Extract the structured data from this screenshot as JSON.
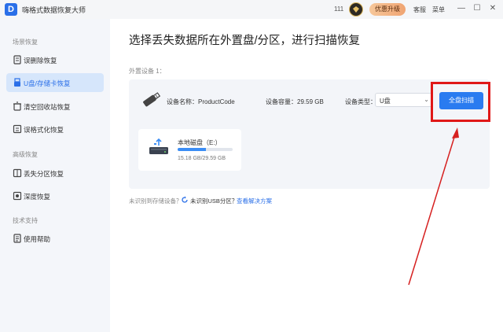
{
  "titlebar": {
    "app_title": "嗨格式数据恢复大师",
    "app_logo_letter": "D",
    "count": "111",
    "upgrade_label": "优惠升级",
    "service_label": "客服",
    "menu_label": "菜单",
    "minimize_glyph": "—",
    "maximize_glyph": "☐",
    "close_glyph": "✕"
  },
  "sidebar": {
    "section_scene": "场景恢复",
    "section_advanced": "高级恢复",
    "section_support": "技术支持",
    "items": [
      {
        "label": "误删除恢复",
        "icon": "deleted-file-icon",
        "active": false
      },
      {
        "label": "U盘/存储卡恢复",
        "icon": "usb-drive-icon",
        "active": true
      },
      {
        "label": "清空回收站恢复",
        "icon": "recycle-bin-icon",
        "active": false
      },
      {
        "label": "误格式化恢复",
        "icon": "format-icon",
        "active": false
      },
      {
        "label": "丢失分区恢复",
        "icon": "partition-icon",
        "active": false
      },
      {
        "label": "深度恢复",
        "icon": "deep-scan-icon",
        "active": false
      },
      {
        "label": "使用帮助",
        "icon": "help-doc-icon",
        "active": false
      }
    ]
  },
  "main": {
    "title": "选择丢失数据所在外置盘/分区，进行扫描恢复",
    "external_label": "外置设备 1：",
    "device": {
      "name_label": "设备名称：ProductCode",
      "capacity_label": "设备容量：29.59 GB",
      "type_label": "设备类型：",
      "type_value": "U盘",
      "scan_button": "全盘扫描"
    },
    "disk": {
      "name": "本地磁盘（E:）",
      "usage": "15.18 GB/29.59 GB",
      "used_fraction": 0.513
    },
    "hint": {
      "unrecognized": "未识别到存储设备？",
      "usb_partition": "未识别USB分区？",
      "solution_link": "查看解决方案"
    }
  },
  "colors": {
    "accent": "#2a7bf0",
    "highlight": "#e01818",
    "sidebar_active": "#d6e6fb"
  }
}
